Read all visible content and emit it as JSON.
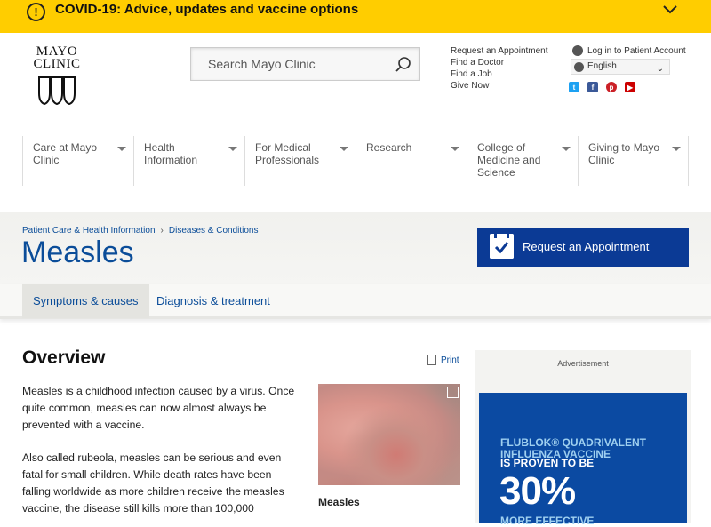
{
  "covid_banner": {
    "text": "COVID-19: Advice, updates and vaccine options",
    "alert_symbol": "!",
    "icon": "chevron-down-icon"
  },
  "logo": {
    "line1": "MAYO",
    "line2": "CLINIC"
  },
  "search": {
    "placeholder": "Search Mayo Clinic",
    "icon": "search-icon"
  },
  "utility_links": [
    "Request an Appointment",
    "Find a Doctor",
    "Find a Job",
    "Give Now"
  ],
  "account": {
    "login_label": "Log in to Patient Account",
    "language": "English"
  },
  "social": [
    {
      "name": "twitter-icon",
      "glyph": "t",
      "color": "#1da1f2"
    },
    {
      "name": "facebook-icon",
      "glyph": "f",
      "color": "#3b5998"
    },
    {
      "name": "pinterest-icon",
      "glyph": "p",
      "color": "#cb2027"
    },
    {
      "name": "youtube-icon",
      "glyph": "▶",
      "color": "#cc0000"
    }
  ],
  "nav": [
    {
      "label": "Care at Mayo Clinic"
    },
    {
      "label": "Health Information"
    },
    {
      "label": "For Medical Professionals"
    },
    {
      "label": "Research"
    },
    {
      "label": "College of Medicine and Science"
    },
    {
      "label": "Giving to Mayo Clinic"
    }
  ],
  "breadcrumb": [
    "Patient Care & Health Information",
    "Diseases & Conditions"
  ],
  "page_title": "Measles",
  "appointment_button": "Request an Appointment",
  "tabs": [
    {
      "label": "Symptoms & causes",
      "active": true
    },
    {
      "label": "Diagnosis & treatment",
      "active": false
    }
  ],
  "content": {
    "heading": "Overview",
    "print_label": "Print",
    "para1": "Measles is a childhood infection caused by a virus. Once quite common, measles can now almost always be prevented with a vaccine.",
    "para2": "Also called rubeola, measles can be serious and even fatal for small children. While death rates have been falling worldwide as more children receive the measles vaccine, the disease still kills more than 100,000",
    "image_caption": "Measles"
  },
  "ad": {
    "label": "Advertisement",
    "line1": "FLUBLOK® QUADRIVALENT INFLUENZA VACCINE",
    "line2": "IS PROVEN TO BE",
    "big": "30%",
    "line3": "MORE EFFECTIVE"
  },
  "colors": {
    "banner": "#ffcd00",
    "brand_blue": "#0b4d99",
    "appointment_bg": "#0b3a95"
  }
}
